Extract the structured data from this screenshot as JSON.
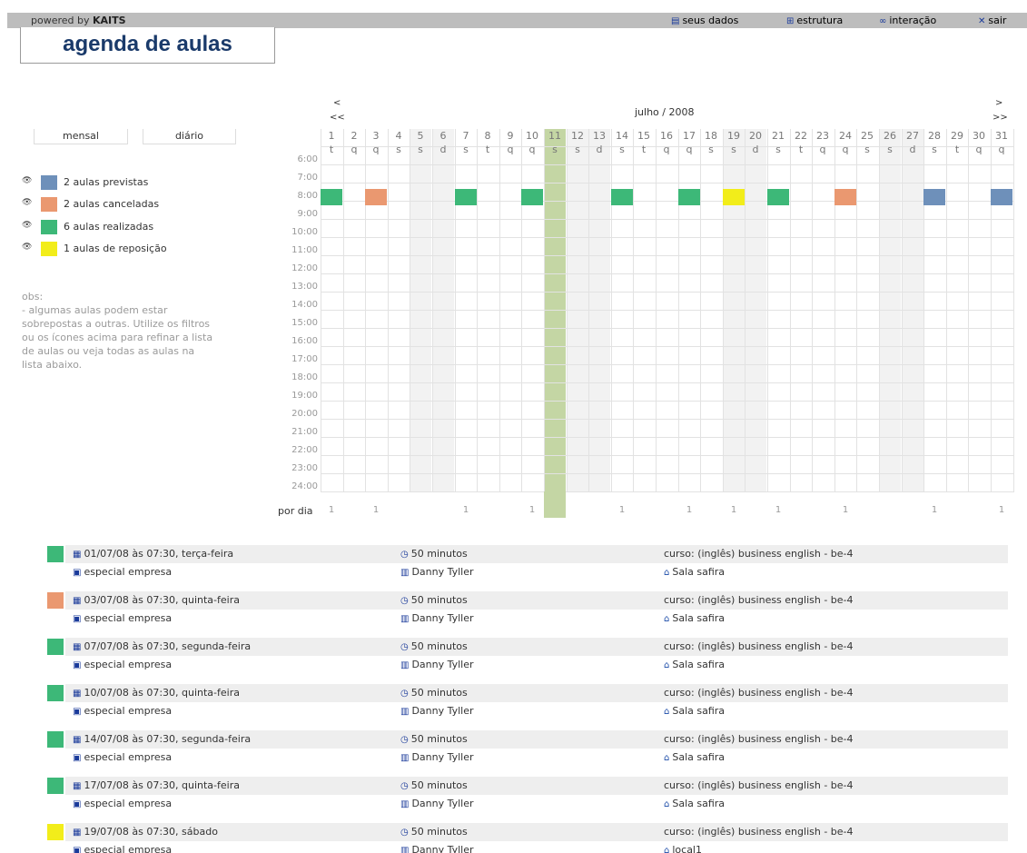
{
  "topbar": {
    "powered_prefix": "powered by",
    "brand": "KAITS",
    "links": [
      {
        "icon": "id-card-icon",
        "glyph": "▤",
        "label": "seus dados"
      },
      {
        "icon": "structure-icon",
        "glyph": "⊞",
        "label": "estrutura"
      },
      {
        "icon": "interaction-icon",
        "glyph": "∞",
        "label": "interação"
      },
      {
        "icon": "close-icon",
        "glyph": "✕",
        "label": "sair"
      }
    ]
  },
  "page": {
    "title": "agenda de aulas"
  },
  "views": {
    "monthly": "mensal",
    "daily": "diário"
  },
  "legend": [
    {
      "color": "#6e90ba",
      "label": "2 aulas previstas"
    },
    {
      "color": "#ea9870",
      "label": "2 aulas canceladas"
    },
    {
      "color": "#3db878",
      "label": "6 aulas realizadas"
    },
    {
      "color": "#f2ed1a",
      "label": "1 aulas de reposição"
    }
  ],
  "obs": {
    "heading": "obs:",
    "lines": [
      "- algumas aulas podem estar",
      "sobrepostas a outras. Utilize os filtros",
      "ou os ícones acima para refinar a lista",
      "de aulas ou veja todas as aulas na",
      "lista abaixo."
    ]
  },
  "calendar": {
    "month_label": "julho / 2008",
    "nav": {
      "prev": "<",
      "prev_year": "<<",
      "next": ">",
      "next_year": ">>"
    },
    "days": [
      {
        "n": "1",
        "w": "t"
      },
      {
        "n": "2",
        "w": "q"
      },
      {
        "n": "3",
        "w": "q"
      },
      {
        "n": "4",
        "w": "s"
      },
      {
        "n": "5",
        "w": "s"
      },
      {
        "n": "6",
        "w": "d"
      },
      {
        "n": "7",
        "w": "s"
      },
      {
        "n": "8",
        "w": "t"
      },
      {
        "n": "9",
        "w": "q"
      },
      {
        "n": "10",
        "w": "q"
      },
      {
        "n": "11",
        "w": "s"
      },
      {
        "n": "12",
        "w": "s"
      },
      {
        "n": "13",
        "w": "d"
      },
      {
        "n": "14",
        "w": "s"
      },
      {
        "n": "15",
        "w": "t"
      },
      {
        "n": "16",
        "w": "q"
      },
      {
        "n": "17",
        "w": "q"
      },
      {
        "n": "18",
        "w": "s"
      },
      {
        "n": "19",
        "w": "s"
      },
      {
        "n": "20",
        "w": "d"
      },
      {
        "n": "21",
        "w": "s"
      },
      {
        "n": "22",
        "w": "t"
      },
      {
        "n": "23",
        "w": "q"
      },
      {
        "n": "24",
        "w": "q"
      },
      {
        "n": "25",
        "w": "s"
      },
      {
        "n": "26",
        "w": "s"
      },
      {
        "n": "27",
        "w": "d"
      },
      {
        "n": "28",
        "w": "s"
      },
      {
        "n": "29",
        "w": "t"
      },
      {
        "n": "30",
        "w": "q"
      },
      {
        "n": "31",
        "w": "q"
      }
    ],
    "weekend_days": [
      5,
      6,
      12,
      13,
      19,
      20,
      26,
      27
    ],
    "today": 11,
    "hours": [
      "6:00",
      "7:00",
      "8:00",
      "9:00",
      "10:00",
      "11:00",
      "12:00",
      "13:00",
      "14:00",
      "15:00",
      "16:00",
      "17:00",
      "18:00",
      "19:00",
      "20:00",
      "21:00",
      "22:00",
      "23:00",
      "24:00"
    ],
    "events": [
      {
        "day": 1,
        "status": "realizada",
        "color": "#3db878"
      },
      {
        "day": 3,
        "status": "cancelada",
        "color": "#ea9870"
      },
      {
        "day": 7,
        "status": "realizada",
        "color": "#3db878"
      },
      {
        "day": 10,
        "status": "realizada",
        "color": "#3db878"
      },
      {
        "day": 14,
        "status": "realizada",
        "color": "#3db878"
      },
      {
        "day": 17,
        "status": "realizada",
        "color": "#3db878"
      },
      {
        "day": 19,
        "status": "reposição",
        "color": "#f2ed1a"
      },
      {
        "day": 21,
        "status": "realizada",
        "color": "#3db878"
      },
      {
        "day": 24,
        "status": "cancelada",
        "color": "#ea9870"
      },
      {
        "day": 28,
        "status": "prevista",
        "color": "#6e90ba"
      },
      {
        "day": 31,
        "status": "prevista",
        "color": "#6e90ba"
      }
    ],
    "per_day_label": "por dia",
    "per_day_counts": [
      {
        "day": 1,
        "v": "1"
      },
      {
        "day": 3,
        "v": "1"
      },
      {
        "day": 7,
        "v": "1"
      },
      {
        "day": 10,
        "v": "1"
      },
      {
        "day": 14,
        "v": "1"
      },
      {
        "day": 17,
        "v": "1"
      },
      {
        "day": 19,
        "v": "1"
      },
      {
        "day": 21,
        "v": "1"
      },
      {
        "day": 24,
        "v": "1"
      },
      {
        "day": 28,
        "v": "1"
      },
      {
        "day": 31,
        "v": "1"
      }
    ]
  },
  "lessons": [
    {
      "color": "#3db878",
      "date": "01/07/08 às 07:30, terça-feira",
      "duration": "50 minutos",
      "course": "curso: (inglês) business english - be-4",
      "type": "especial empresa",
      "teacher": "Danny Tyller",
      "room": "Sala safira"
    },
    {
      "color": "#ea9870",
      "date": "03/07/08 às 07:30, quinta-feira",
      "duration": "50 minutos",
      "course": "curso: (inglês) business english - be-4",
      "type": "especial empresa",
      "teacher": "Danny Tyller",
      "room": "Sala safira"
    },
    {
      "color": "#3db878",
      "date": "07/07/08 às 07:30, segunda-feira",
      "duration": "50 minutos",
      "course": "curso: (inglês) business english - be-4",
      "type": "especial empresa",
      "teacher": "Danny Tyller",
      "room": "Sala safira"
    },
    {
      "color": "#3db878",
      "date": "10/07/08 às 07:30, quinta-feira",
      "duration": "50 minutos",
      "course": "curso: (inglês) business english - be-4",
      "type": "especial empresa",
      "teacher": "Danny Tyller",
      "room": "Sala safira"
    },
    {
      "color": "#3db878",
      "date": "14/07/08 às 07:30, segunda-feira",
      "duration": "50 minutos",
      "course": "curso: (inglês) business english - be-4",
      "type": "especial empresa",
      "teacher": "Danny Tyller",
      "room": "Sala safira"
    },
    {
      "color": "#3db878",
      "date": "17/07/08 às 07:30, quinta-feira",
      "duration": "50 minutos",
      "course": "curso: (inglês) business english - be-4",
      "type": "especial empresa",
      "teacher": "Danny Tyller",
      "room": "Sala safira"
    },
    {
      "color": "#f2ed1a",
      "date": "19/07/08 às 07:30, sábado",
      "duration": "50 minutos",
      "course": "curso: (inglês) business english - be-4",
      "type": "especial empresa",
      "teacher": "Danny Tyller",
      "room": "local1"
    }
  ]
}
